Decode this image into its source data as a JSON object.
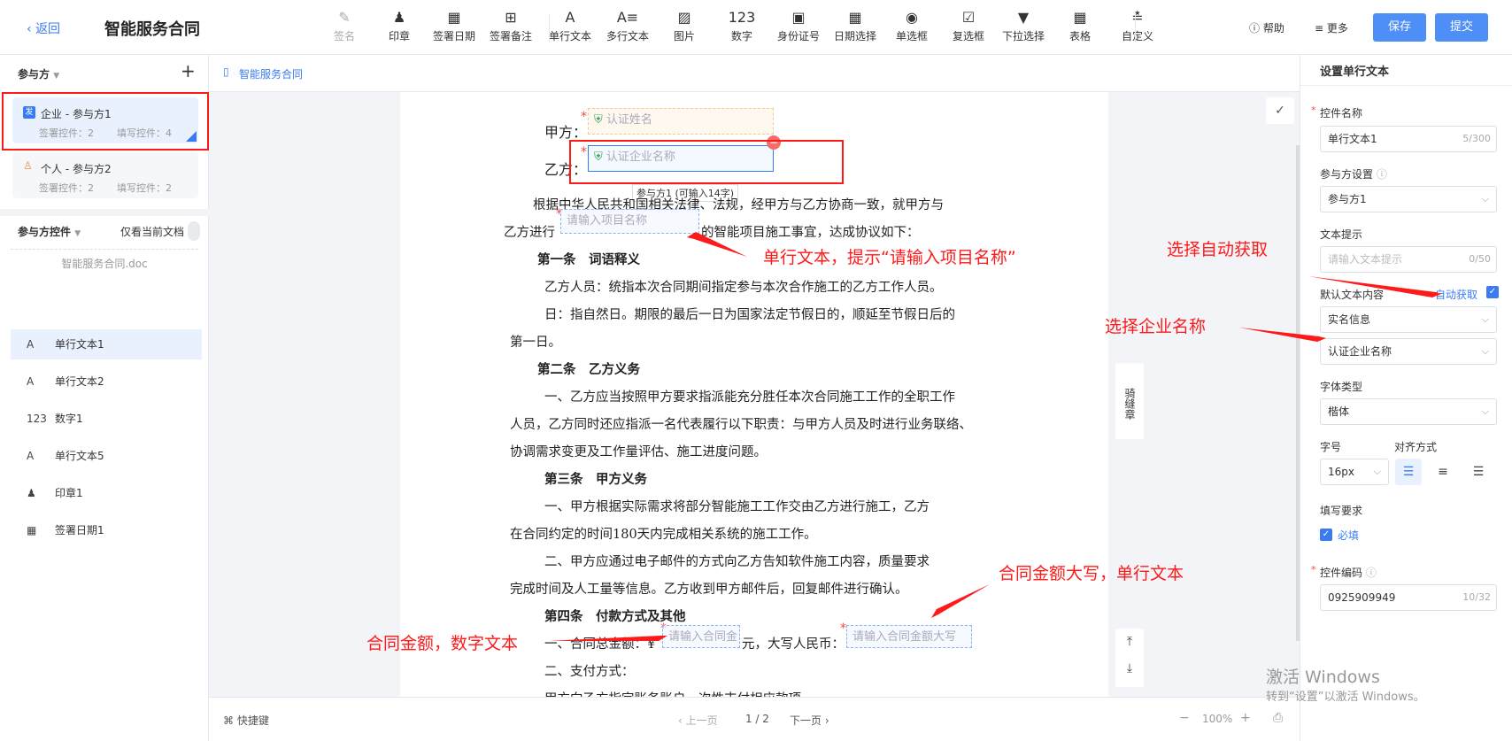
{
  "header": {
    "back": "返回",
    "title": "智能服务合同",
    "help": "帮助",
    "more": "更多",
    "save": "保存",
    "submit": "提交"
  },
  "toolbar": [
    {
      "label": "签名",
      "icon": "✎"
    },
    {
      "label": "印章",
      "icon": "♟"
    },
    {
      "label": "签署日期",
      "icon": "▦"
    },
    {
      "label": "签署备注",
      "icon": "⊞"
    },
    {
      "label": "单行文本",
      "icon": "A"
    },
    {
      "label": "多行文本",
      "icon": "A≡"
    },
    {
      "label": "图片",
      "icon": "▨"
    },
    {
      "label": "数字",
      "icon": "123"
    },
    {
      "label": "身份证号",
      "icon": "▣"
    },
    {
      "label": "日期选择",
      "icon": "▦"
    },
    {
      "label": "单选框",
      "icon": "◉"
    },
    {
      "label": "复选框",
      "icon": "☑"
    },
    {
      "label": "下拉选择",
      "icon": "▼"
    },
    {
      "label": "表格",
      "icon": "▦"
    },
    {
      "label": "自定义",
      "icon": "≛"
    }
  ],
  "left": {
    "parties_title": "参与方",
    "add": "+",
    "party1": {
      "name": "企业 - 参与方1",
      "sign": "签署控件：2",
      "fill": "填写控件：4",
      "badge": "发"
    },
    "party2": {
      "name": "个人 - 参与方2",
      "sign": "签署控件：2",
      "fill": "填写控件：2"
    },
    "controls_title": "参与方控件",
    "only_current": "仅看当前文档",
    "file": "智能服务合同.doc",
    "controls": [
      {
        "label": "单行文本1",
        "icon": "A"
      },
      {
        "label": "单行文本2",
        "icon": "A"
      },
      {
        "label": "数字1",
        "icon": "123"
      },
      {
        "label": "单行文本5",
        "icon": "A"
      },
      {
        "label": "印章1",
        "icon": "♟"
      },
      {
        "label": "签署日期1",
        "icon": "▦"
      }
    ]
  },
  "breadcrumb": "智能服务合同",
  "doc": {
    "jia": "甲方：",
    "yi": "乙方：",
    "f1": "认证姓名",
    "f2": "认证企业名称",
    "tip": "参与方1 (可输入14字)",
    "l1": "根据中华人民共和国相关法律、法规，经甲方与乙方协商一致，就甲方与",
    "l2a": "乙方进行",
    "f3": "请输入项目名称",
    "l2b": "的智能项目施工事宜，达成协议如下：",
    "a1": "第一条　词语释义",
    "l3": "乙方人员：统指本次合同期间指定参与本次合作施工的乙方工作人员。",
    "l4": "日：指自然日。期限的最后一日为国家法定节假日的，顺延至节假日后的",
    "l5": "第一日。",
    "a2": "第二条　乙方义务",
    "l6": "一、乙方应当按照甲方要求指派能充分胜任本次合同施工工作的全职工作",
    "l7": "人员，乙方同时还应指派一名代表履行以下职责：与甲方人员及时进行业务联络、",
    "l8": "协调需求变更及工作量评估、施工进度问题。",
    "a3": "第三条　甲方义务",
    "l9": "一、甲方根据实际需求将部分智能施工工作交由乙方进行施工，乙方",
    "l10": "在合同约定的时间180天内完成相关系统的施工工作。",
    "l11": "二、甲方应通过电子邮件的方式向乙方告知软件施工内容，质量要求",
    "l12": "完成时间及人工量等信息。乙方收到甲方邮件后，回复邮件进行确认。",
    "a4": "第四条　付款方式及其他",
    "l13a": "一、合同总金额：¥",
    "f4": "请输入合同金",
    "l13b": "元，大写人民币：",
    "f5": "请输入合同金额大写",
    "l14": "二、支付方式：",
    "l15": "甲方向乙方指定账务账户一次性支付相应款项。",
    "stamp": "骑缝章"
  },
  "annotations": {
    "a1": "单行文本，提示“请输入项目名称”",
    "a2": "选择自动获取",
    "a3": "选择企业名称",
    "a4": "合同金额大写，单行文本",
    "a5": "合同金额，数字文本"
  },
  "status": {
    "shortcut": "快捷键",
    "prev": "上一页",
    "page": "1 / 2",
    "next": "下一页",
    "zoom": "100%"
  },
  "right": {
    "title": "设置单行文本",
    "name_lbl": "控件名称",
    "name_val": "单行文本1",
    "name_cnt": "5/300",
    "party_lbl": "参与方设置",
    "party_val": "参与方1",
    "hint_lbl": "文本提示",
    "hint_ph": "请输入文本提示",
    "hint_cnt": "0/50",
    "default_lbl": "默认文本内容",
    "auto": "自动获取",
    "src": "实名信息",
    "srcval": "认证企业名称",
    "font_lbl": "字体类型",
    "font": "楷体",
    "size_lbl": "字号",
    "size": "16px",
    "align_lbl": "对齐方式",
    "req_lbl": "填写要求",
    "req": "必填",
    "code_lbl": "控件编码",
    "code": "0925909949",
    "code_cnt": "10/32"
  },
  "watermark": {
    "line1": "激活 Windows",
    "line2": "转到“设置”以激活 Windows。"
  },
  "colors": {
    "accent": "#4e8ef7",
    "annotation": "#ff1a1a"
  }
}
